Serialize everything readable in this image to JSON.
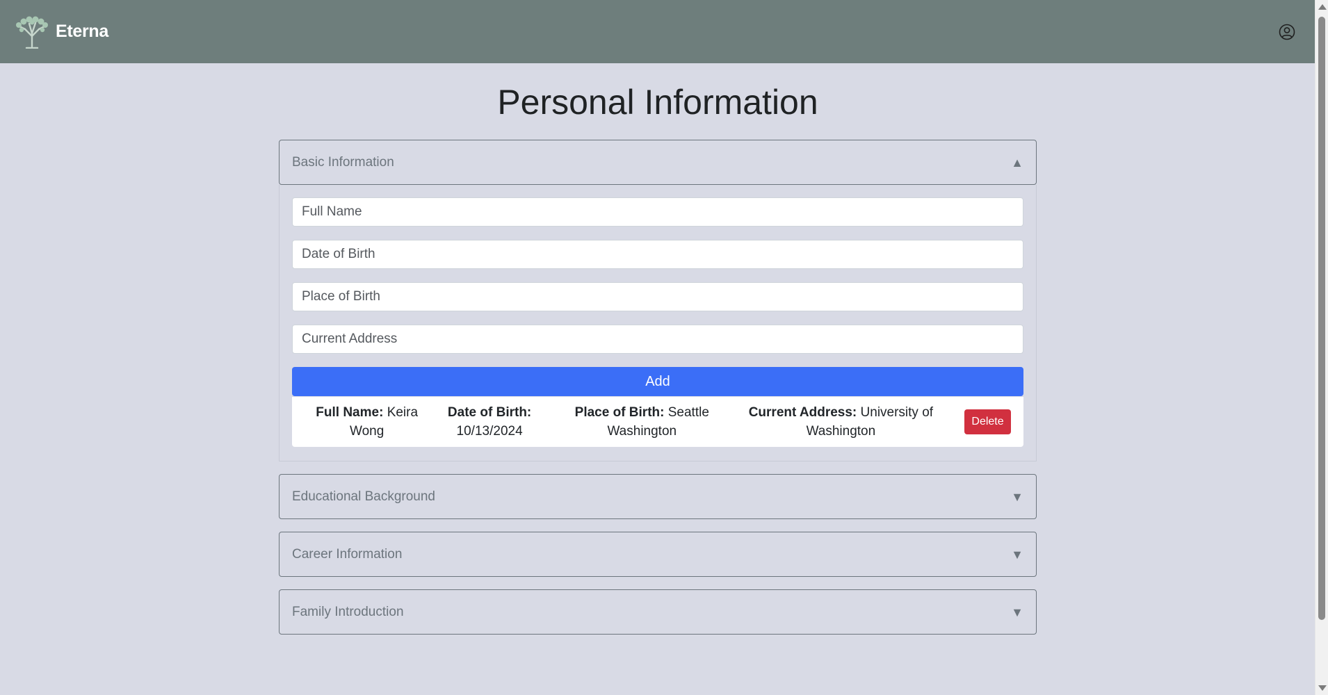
{
  "header": {
    "brand": "Eterna",
    "profile_icon": "user-circle-icon",
    "logo_icon": "tree-logo-icon"
  },
  "main": {
    "title": "Personal Information",
    "sections": [
      {
        "label": "Basic Information",
        "state": "expanded",
        "arrow": "▲"
      },
      {
        "label": "Educational Background",
        "state": "collapsed",
        "arrow": "▼"
      },
      {
        "label": "Career Information",
        "state": "collapsed",
        "arrow": "▼"
      },
      {
        "label": "Family Introduction",
        "state": "collapsed",
        "arrow": "▼"
      }
    ],
    "form": {
      "full_name": {
        "placeholder": "Full Name",
        "value": ""
      },
      "date_of_birth": {
        "placeholder": "Date of Birth",
        "value": ""
      },
      "place_of_birth": {
        "placeholder": "Place of Birth",
        "value": ""
      },
      "current_address": {
        "placeholder": "Current Address",
        "value": ""
      },
      "add_label": "Add"
    },
    "entry": {
      "full_name_label": "Full Name:",
      "full_name_value": "Keira Wong",
      "dob_label": "Date of Birth:",
      "dob_value": "10/13/2024",
      "pob_label": "Place of Birth:",
      "pob_value": "Seattle Washington",
      "address_label": "Current Address:",
      "address_value": "University of Washington",
      "delete_label": "Delete"
    }
  },
  "colors": {
    "header_bg": "#6e7e7c",
    "page_bg": "#d8dae5",
    "primary": "#3b6ef7",
    "danger": "#d1303f"
  }
}
